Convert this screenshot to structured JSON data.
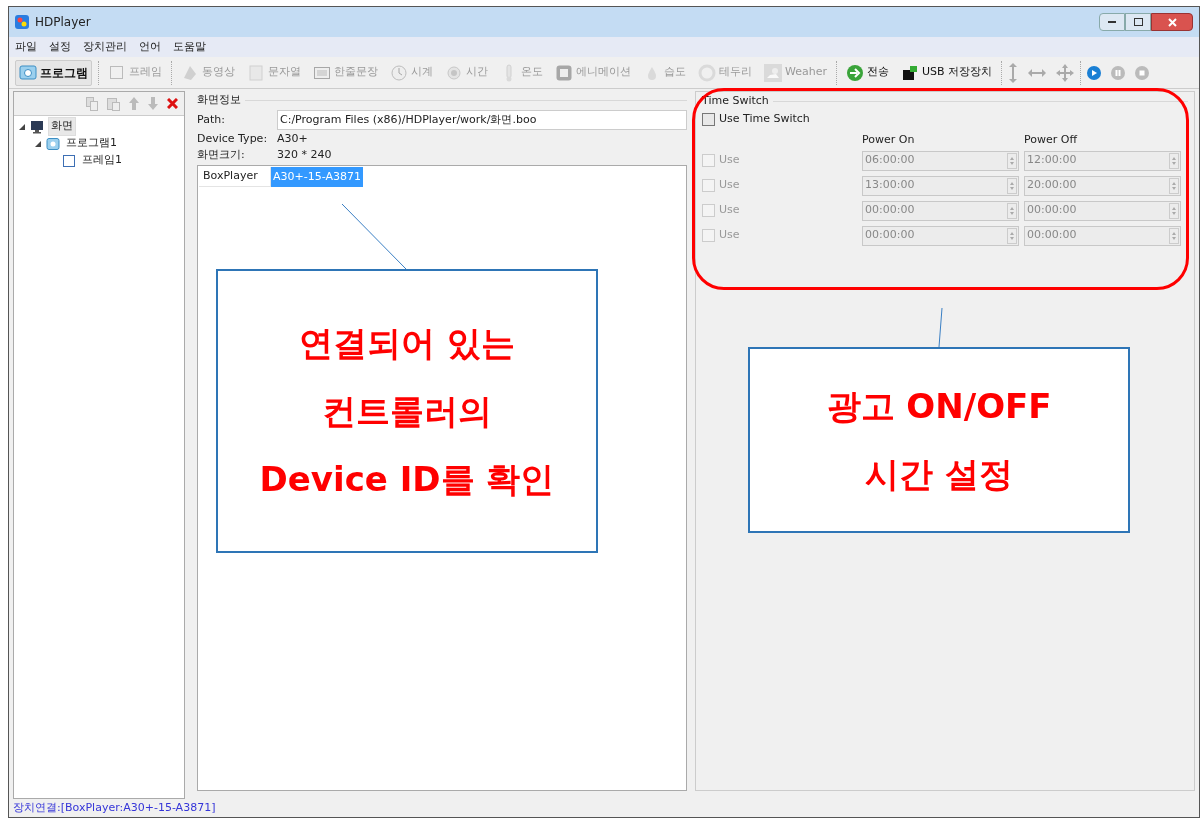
{
  "window": {
    "title": "HDPlayer"
  },
  "menu": [
    "파일",
    "설정",
    "장치관리",
    "언어",
    "도움말"
  ],
  "toolbar": [
    [
      {
        "label": "프로그램",
        "disabled": false
      }
    ],
    [
      {
        "label": "프레임",
        "disabled": true
      }
    ],
    [
      {
        "label": "동영상",
        "disabled": true
      },
      {
        "label": "문자열",
        "disabled": true
      },
      {
        "label": "한줄문장",
        "disabled": true
      },
      {
        "label": "시계",
        "disabled": true
      },
      {
        "label": "시간",
        "disabled": true
      },
      {
        "label": "온도",
        "disabled": true
      },
      {
        "label": "에니메이션",
        "disabled": true
      },
      {
        "label": "습도",
        "disabled": true
      },
      {
        "label": "테두리",
        "disabled": true
      },
      {
        "label": "Weaher",
        "disabled": true
      }
    ],
    [
      {
        "label": "전송",
        "disabled": false
      },
      {
        "label": "USB 저장장치",
        "disabled": false
      }
    ]
  ],
  "tree": [
    {
      "label": "화면",
      "selected": true,
      "expanded": true,
      "children": [
        {
          "label": "프로그램1",
          "selected": false,
          "expanded": true,
          "children": [
            {
              "label": "프레임1",
              "selected": false
            }
          ]
        }
      ]
    }
  ],
  "screen_info": {
    "title": "화면정보",
    "path_label": "Path:",
    "path": "C:/Program Files (x86)/HDPlayer/work/화면.boo",
    "device_type_label": "Device Type:",
    "device_type": "A30+",
    "size_label": "화면크기:",
    "size": "320 * 240",
    "devices": [
      {
        "name": "BoxPlayer",
        "id": "A30+-15-A3871",
        "selected": true
      }
    ]
  },
  "time_switch": {
    "title": "Time Switch",
    "use_label": "Use Time Switch",
    "checked": false,
    "on_header": "Power On",
    "off_header": "Power Off",
    "rows": [
      {
        "label": "Use",
        "checked": false,
        "disabled": true,
        "on": "06:00:00",
        "off": "12:00:00"
      },
      {
        "label": "Use",
        "checked": false,
        "disabled": true,
        "on": "13:00:00",
        "off": "20:00:00"
      },
      {
        "label": "Use",
        "checked": false,
        "disabled": true,
        "on": "00:00:00",
        "off": "00:00:00"
      },
      {
        "label": "Use",
        "checked": false,
        "disabled": true,
        "on": "00:00:00",
        "off": "00:00:00"
      }
    ]
  },
  "status_bar": "장치연결:[BoxPlayer:A30+-15-A3871]",
  "annotations": [
    {
      "lines": [
        "연결되어 있는",
        "컨트롤러의",
        "Device ID를 확인"
      ]
    },
    {
      "lines": [
        "광고 ON/OFF",
        "시간 설정"
      ]
    }
  ]
}
